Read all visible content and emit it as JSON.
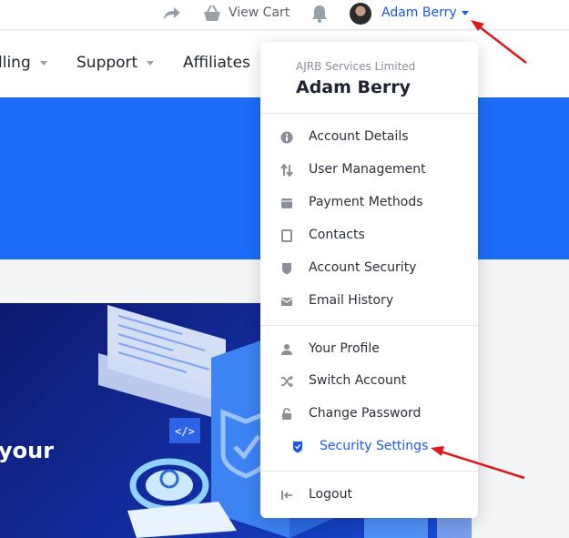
{
  "topbar": {
    "view_cart_label": "View Cart",
    "user_name": "Adam Berry"
  },
  "nav": {
    "items": [
      {
        "label": "lling",
        "has_caret": true
      },
      {
        "label": "Support",
        "has_caret": true
      },
      {
        "label": "Affiliates",
        "has_caret": false
      }
    ]
  },
  "banner": {
    "text": "your"
  },
  "dropdown": {
    "company": "AJRB Services Limited",
    "name": "Adam Berry",
    "account_items": [
      {
        "label": "Account Details",
        "icon": "info-icon"
      },
      {
        "label": "User Management",
        "icon": "sort-arrows-icon"
      },
      {
        "label": "Payment Methods",
        "icon": "wallet-icon"
      },
      {
        "label": "Contacts",
        "icon": "contact-book-icon"
      },
      {
        "label": "Account Security",
        "icon": "shield-icon"
      },
      {
        "label": "Email History",
        "icon": "envelope-icon"
      }
    ],
    "profile_items": [
      {
        "label": "Your Profile",
        "icon": "user-icon"
      },
      {
        "label": "Switch Account",
        "icon": "shuffle-icon"
      },
      {
        "label": "Change Password",
        "icon": "lock-icon"
      },
      {
        "label": "Security Settings",
        "icon": "shield-check-icon"
      }
    ],
    "logout_label": "Logout"
  },
  "colors": {
    "accent": "#1e57e8",
    "hero_blue": "#1c6cf7",
    "annotation_red": "#e0161b"
  }
}
